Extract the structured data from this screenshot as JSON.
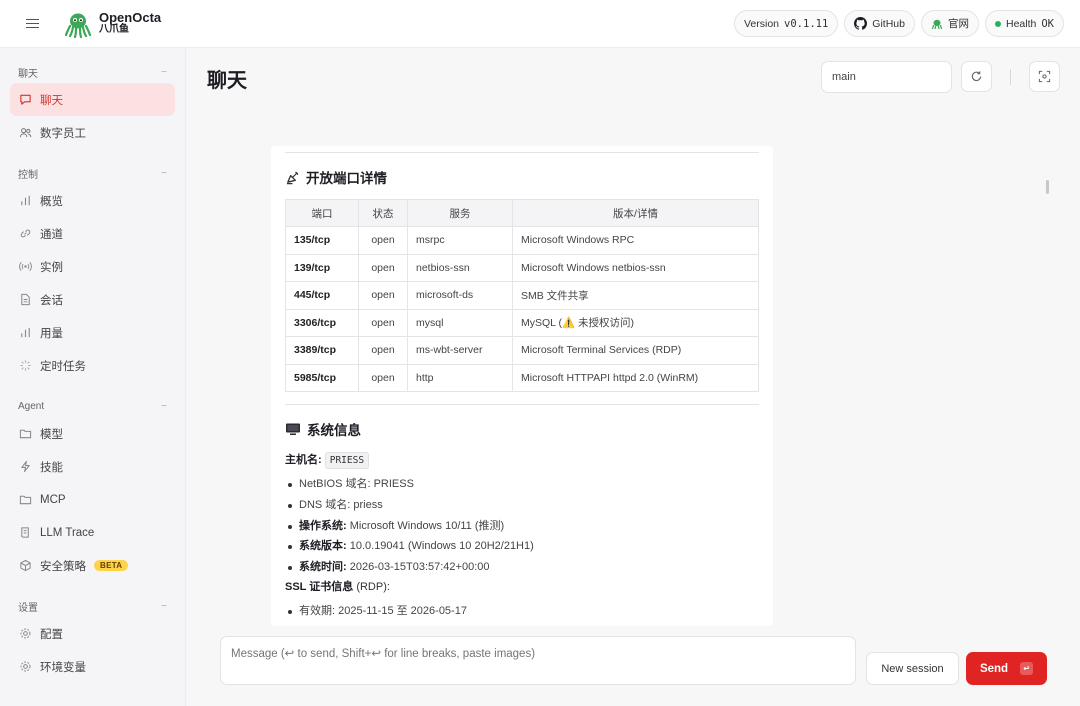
{
  "brand": {
    "name": "OpenOcta",
    "subtitle": "八爪鱼"
  },
  "header": {
    "version_label": "Version",
    "version_value": "v0.1.11",
    "github_label": "GitHub",
    "website_label": "官网",
    "health_label": "Health",
    "health_value": "OK",
    "health_color": "#22b35e"
  },
  "sidebar": {
    "sections": [
      {
        "title": "聊天",
        "items": [
          {
            "label": "聊天",
            "icon": "chat-icon",
            "active": true
          },
          {
            "label": "数字员工",
            "icon": "users-icon"
          }
        ]
      },
      {
        "title": "控制",
        "items": [
          {
            "label": "概览",
            "icon": "bar-chart-icon"
          },
          {
            "label": "通道",
            "icon": "link-icon"
          },
          {
            "label": "实例",
            "icon": "broadcast-icon"
          },
          {
            "label": "会话",
            "icon": "document-icon"
          },
          {
            "label": "用量",
            "icon": "bar-chart-icon"
          },
          {
            "label": "定时任务",
            "icon": "loader-icon"
          }
        ]
      },
      {
        "title": "Agent",
        "items": [
          {
            "label": "模型",
            "icon": "folder-icon"
          },
          {
            "label": "技能",
            "icon": "zap-icon"
          },
          {
            "label": "MCP",
            "icon": "folder-icon"
          },
          {
            "label": "LLM Trace",
            "icon": "scroll-icon"
          },
          {
            "label": "安全策略",
            "icon": "cube-icon",
            "badge": "BETA"
          }
        ]
      },
      {
        "title": "设置",
        "items": [
          {
            "label": "配置",
            "icon": "gear-icon"
          },
          {
            "label": "环境变量",
            "icon": "gear-icon"
          }
        ]
      }
    ],
    "collapse_symbol": "−"
  },
  "main": {
    "title": "聊天",
    "session_key": "main"
  },
  "message": {
    "ports_heading": "开放端口详情",
    "ports_table": {
      "headers": [
        "端口",
        "状态",
        "服务",
        "版本/详情"
      ],
      "rows": [
        [
          "135/tcp",
          "open",
          "msrpc",
          "Microsoft Windows RPC"
        ],
        [
          "139/tcp",
          "open",
          "netbios-ssn",
          "Microsoft Windows netbios-ssn"
        ],
        [
          "445/tcp",
          "open",
          "microsoft-ds",
          "SMB 文件共享"
        ],
        [
          "3306/tcp",
          "open",
          "mysql",
          "MySQL (⚠️ 未授权访问)"
        ],
        [
          "3389/tcp",
          "open",
          "ms-wbt-server",
          "Microsoft Terminal Services (RDP)"
        ],
        [
          "5985/tcp",
          "open",
          "http",
          "Microsoft HTTPAPI httpd 2.0 (WinRM)"
        ]
      ]
    },
    "sys_heading": "系统信息",
    "hostname_label": "主机名:",
    "hostname_value": "PRIESS",
    "sys_items": [
      {
        "label": "NetBIOS 域名:",
        "value": " PRIESS",
        "bold": false
      },
      {
        "label": "DNS 域名:",
        "value": " priess",
        "bold": false
      },
      {
        "label": "操作系统:",
        "value": " Microsoft Windows 10/11 (推测)",
        "bold": true
      },
      {
        "label": "系统版本:",
        "value": " 10.0.19041 (Windows 10 20H2/21H1)",
        "bold": true
      },
      {
        "label": "系统时间:",
        "value": " 2026-03-15T03:57:42+00:00",
        "bold": true
      }
    ],
    "ssl_label": "SSL 证书信息",
    "ssl_suffix": " (RDP):",
    "ssl_items": [
      {
        "label": "有效期:",
        "value": " 2025-11-15 至 2026-05-17"
      }
    ]
  },
  "composer": {
    "placeholder": "Message (↩ to send, Shift+↩ for line breaks, paste images)",
    "new_session_label": "New session",
    "send_label": "Send",
    "send_kbd": "↵"
  },
  "colors": {
    "accent": "#e02424",
    "active_bg": "#fbe1e1",
    "active_text": "#d43333"
  }
}
